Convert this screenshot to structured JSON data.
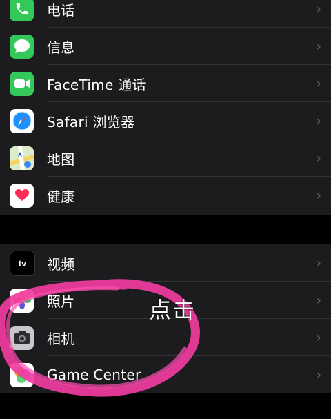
{
  "group1": [
    {
      "name": "phone",
      "label": "电话",
      "icon": "phone-icon",
      "color": "#34c759"
    },
    {
      "name": "messages",
      "label": "信息",
      "icon": "messages-icon",
      "color": "#34c759"
    },
    {
      "name": "facetime",
      "label": "FaceTime 通话",
      "icon": "facetime-icon",
      "color": "#34c759"
    },
    {
      "name": "safari",
      "label": "Safari 浏览器",
      "icon": "safari-icon",
      "color": "#0a84ff"
    },
    {
      "name": "maps",
      "label": "地图",
      "icon": "maps-icon",
      "color": "#4cd964"
    },
    {
      "name": "health",
      "label": "健康",
      "icon": "health-icon",
      "color": "#ff2d55"
    }
  ],
  "group2": [
    {
      "name": "tv",
      "label": "视频",
      "icon": "tv-icon",
      "color": "#000000"
    },
    {
      "name": "photos",
      "label": "照片",
      "icon": "photos-icon",
      "color": "#ffffff"
    },
    {
      "name": "camera",
      "label": "相机",
      "icon": "camera-icon",
      "color": "#8e8e93"
    },
    {
      "name": "game-center",
      "label": "Game Center",
      "icon": "game-center-icon",
      "color": "#ffffff"
    }
  ],
  "annotation": "点击",
  "chevron": "›",
  "tv_badge": "tv",
  "colors": {
    "background": "#000000",
    "cell": "#1c1c1e",
    "separator": "#333336",
    "highlight": "#f03ca0"
  }
}
